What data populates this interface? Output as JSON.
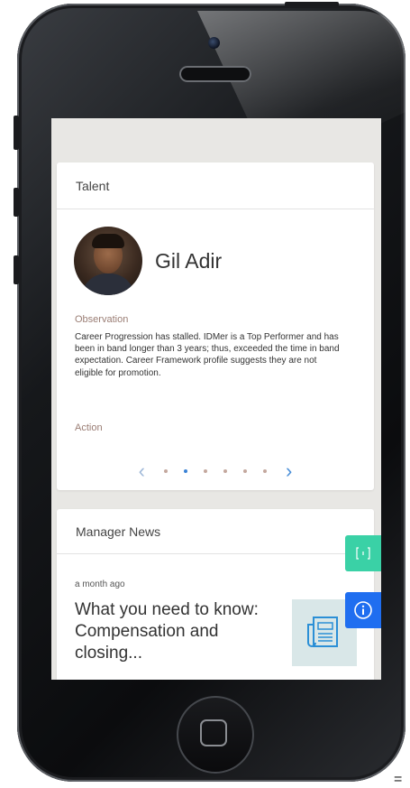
{
  "talent_card": {
    "title": "Talent",
    "person_name": "Gil Adir",
    "observation_label": "Observation",
    "observation_text": "Career Progression has stalled. IDMer is a Top Performer and has been in band longer than 3 years; thus, exceeded the time in band expectation. Career Framework profile suggests they are not eligible for promotion.",
    "action_label": "Action",
    "pager": {
      "prev_icon": "chevron-left-icon",
      "next_icon": "chevron-right-icon",
      "total_pages": 6,
      "active_page": 2
    }
  },
  "news_card": {
    "title": "Manager News",
    "time": "a month ago",
    "headline": "What you need to know: Compensation and closing..."
  },
  "floating_buttons": {
    "feedback_icon": "feedback-icon",
    "info_icon": "info-icon"
  },
  "colors": {
    "accent_blue": "#1f6ef0",
    "accent_green": "#3ad1a6",
    "label_brown": "#9a7d74",
    "screen_background": "#e8e7e4"
  }
}
